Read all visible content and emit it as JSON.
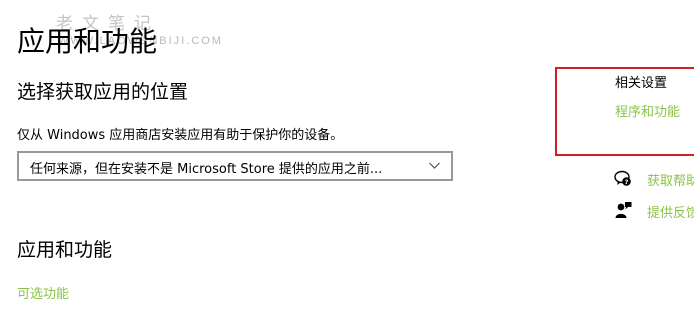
{
  "watermark": {
    "text": "老文笔记",
    "url": "WWW.LAOWENBIJI.COM"
  },
  "page_title": "应用和功能",
  "choose_source": {
    "heading": "选择获取应用的位置",
    "description": "仅从 Windows 应用商店安装应用有助于保护你的设备。",
    "dropdown_value": "任何来源，但在安装不是 Microsoft Store 提供的应用之前..."
  },
  "apps_features": {
    "heading": "应用和功能",
    "optional_features_link": "可选功能"
  },
  "related_settings": {
    "heading": "相关设置",
    "programs_features_link": "程序和功能"
  },
  "support_links": {
    "get_help": "获取帮助",
    "give_feedback": "提供反馈"
  },
  "colors": {
    "accent": "#8bc34a",
    "highlight": "#d01f26"
  }
}
